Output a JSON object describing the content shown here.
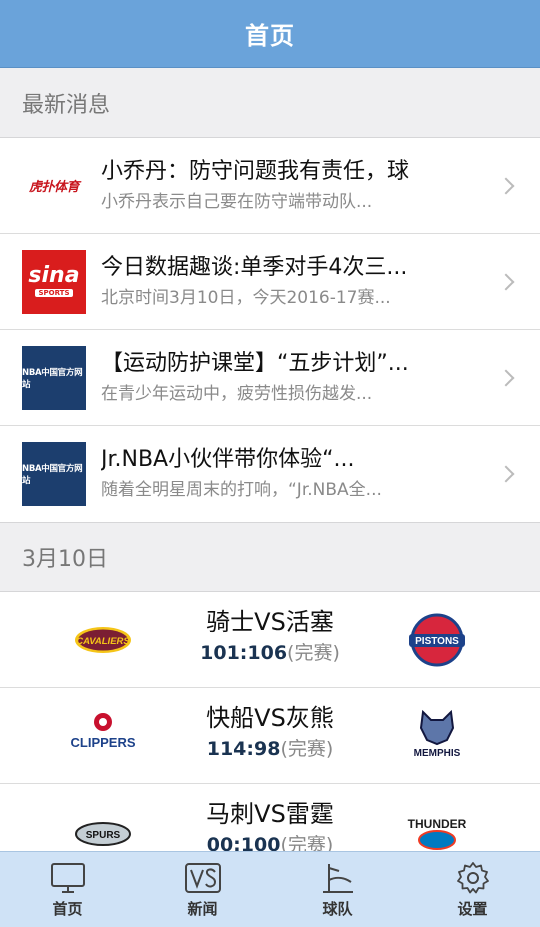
{
  "header": {
    "title": "首页"
  },
  "latest_news": {
    "section_title": "最新消息",
    "items": [
      {
        "logo": "hupu-sports-logo",
        "logo_text": "虎扑体育",
        "title": "小乔丹：防守问题我有责任，球",
        "subtitle": "小乔丹表示自己要在防守端带动队..."
      },
      {
        "logo": "sina-sports-logo",
        "logo_text": "sina",
        "logo_sub": "SPORTS",
        "title": "今日数据趣谈:单季对手4次三...",
        "subtitle": "北京时间3月10日，今天2016-17赛..."
      },
      {
        "logo": "nba-china-logo",
        "logo_text": "NBA中国官方网站",
        "title": "【运动防护课堂】“五步计划”...",
        "subtitle": "在青少年运动中，疲劳性损伤越发..."
      },
      {
        "logo": "nba-china-logo",
        "logo_text": "NBA中国官方网站",
        "title": "Jr.NBA小伙伴带你体验“...",
        "subtitle": "随着全明星周末的打响，“Jr.NBA全..."
      }
    ]
  },
  "games": {
    "section_title": "3月10日",
    "items": [
      {
        "matchup": "骑士VS活塞",
        "score": "101:106",
        "status": "(完赛)",
        "home_logo": "cavaliers-logo",
        "home_text": "CAVALIERS",
        "away_logo": "pistons-logo",
        "away_text": "PISTONS"
      },
      {
        "matchup": "快船VS灰熊",
        "score": "114:98",
        "status": "(完赛)",
        "home_logo": "clippers-logo",
        "home_text": "CLIPPERS",
        "away_logo": "grizzlies-logo",
        "away_text": "MEMPHIS"
      },
      {
        "matchup": "马刺VS雷霆",
        "score": "00:100",
        "status": "(完赛)",
        "home_logo": "spurs-logo",
        "home_text": "SPURS",
        "away_logo": "thunder-logo",
        "away_text": "THUNDER"
      }
    ]
  },
  "tabbar": {
    "tabs": [
      {
        "label": "首页",
        "icon": "monitor-icon"
      },
      {
        "label": "新闻",
        "icon": "vs-icon"
      },
      {
        "label": "球队",
        "icon": "court-icon"
      },
      {
        "label": "设置",
        "icon": "gear-icon"
      }
    ]
  },
  "colors": {
    "header_bg": "#6aa3da",
    "tabbar_bg": "#cfe2f6",
    "score_color": "#1a3351"
  }
}
